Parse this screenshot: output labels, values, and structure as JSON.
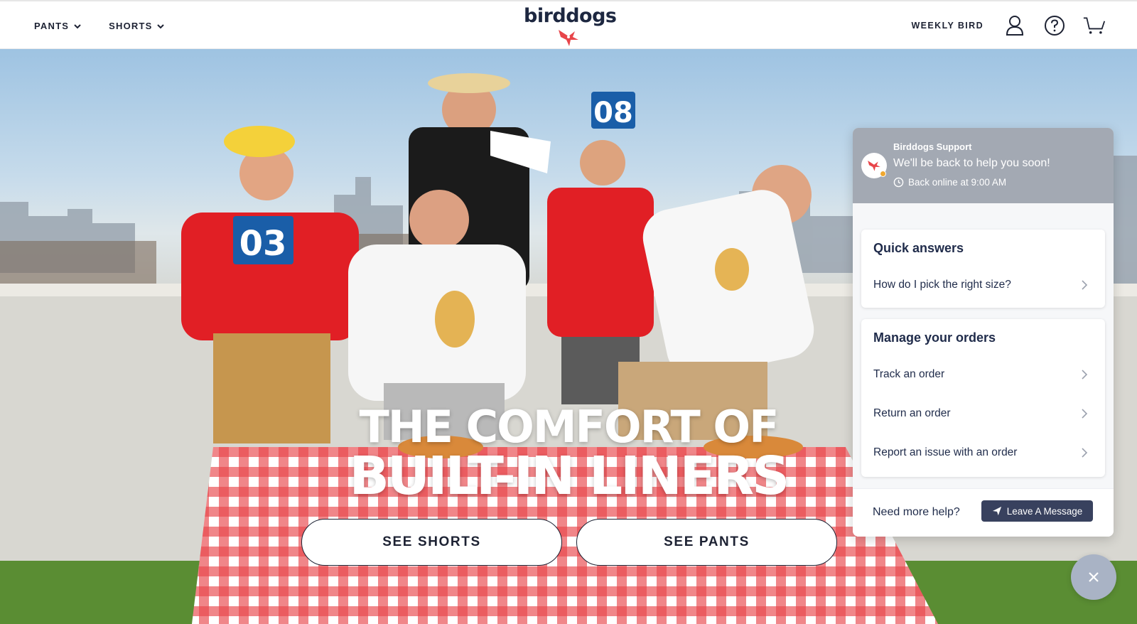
{
  "header": {
    "nav_left": [
      {
        "label": "PANTS"
      },
      {
        "label": "SHORTS"
      }
    ],
    "logo_text": "birddogs",
    "nav_right": {
      "weekly_label": "WEEKLY BIRD",
      "icons": [
        "account-icon",
        "help-icon",
        "cart-icon"
      ]
    }
  },
  "hero": {
    "headline_line1": "THE COMFORT OF",
    "headline_line2": "BUILT-IN LINERS",
    "cta_shorts": "SEE SHORTS",
    "cta_pants": "SEE PANTS",
    "score_cards": [
      "03",
      "08"
    ]
  },
  "support": {
    "name": "Birddogs Support",
    "message": "We'll be back to help you soon!",
    "status": "Back online at 9:00 AM",
    "quick_answers": {
      "title": "Quick answers",
      "items": [
        "How do I pick the right size?"
      ]
    },
    "manage_orders": {
      "title": "Manage your orders",
      "items": [
        "Track an order",
        "Return an order",
        "Report an issue with an order"
      ]
    },
    "footer_prompt": "Need more help?",
    "leave_message_label": "Leave A Message"
  },
  "colors": {
    "navy": "#1d2233",
    "brand_red": "#e8454a",
    "widget_header": "#a3a9b3",
    "button_dark": "#38415e"
  }
}
